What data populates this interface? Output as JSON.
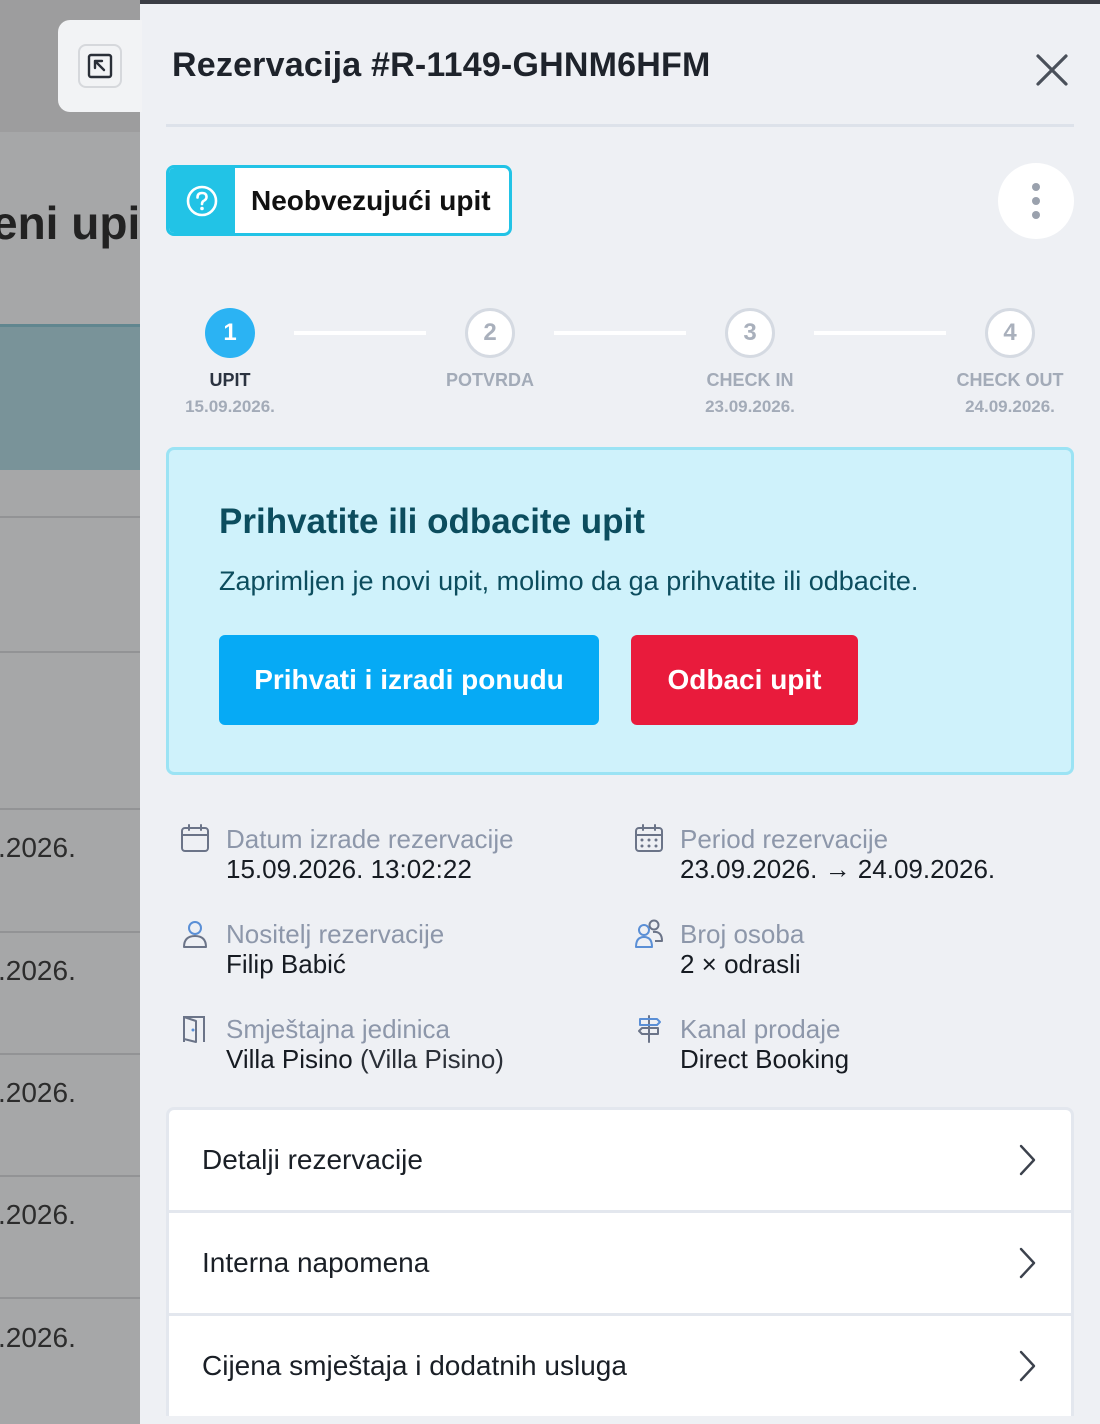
{
  "background": {
    "heading_fragment": "eni upi",
    "date_fragments": [
      ".2026.",
      ".2026.",
      ".2026.",
      ".2026.",
      ".2026."
    ]
  },
  "panel": {
    "title": "Rezervacija #R-1149-GHNM6HFM",
    "status_badge": {
      "label": "Neobvezujući upit",
      "icon": "question-circle-icon",
      "color": "#22c3e6"
    }
  },
  "stepper": [
    {
      "number": "1",
      "label": "UPIT",
      "date": "15.09.2026.",
      "active": true
    },
    {
      "number": "2",
      "label": "POTVRDA",
      "date": "",
      "active": false
    },
    {
      "number": "3",
      "label": "CHECK IN",
      "date": "23.09.2026.",
      "active": false
    },
    {
      "number": "4",
      "label": "CHECK OUT",
      "date": "24.09.2026.",
      "active": false
    }
  ],
  "alert": {
    "title": "Prihvatite ili odbacite upit",
    "text": "Zaprimljen je novi upit, molimo da ga prihvatite ili odbacite.",
    "accept_label": "Prihvati i izradi ponudu",
    "reject_label": "Odbaci upit"
  },
  "info": {
    "created": {
      "label": "Datum izrade rezervacije",
      "value": "15.09.2026. 13:02:22",
      "icon": "calendar-icon"
    },
    "period": {
      "label": "Period rezervacije",
      "value": "23.09.2026. → 24.09.2026.",
      "icon": "calendar-grid-icon"
    },
    "holder": {
      "label": "Nositelj rezervacije",
      "value": "Filip Babić",
      "icon": "user-icon"
    },
    "guests": {
      "label": "Broj osoba",
      "value": "2 × odrasli",
      "icon": "users-icon"
    },
    "unit": {
      "label": "Smještajna jedinica",
      "value": "Villa Pisino",
      "value_suffix": "(Villa Pisino)",
      "icon": "door-icon"
    },
    "channel": {
      "label": "Kanal prodaje",
      "value": "Direct Booking",
      "icon": "signpost-icon"
    }
  },
  "sections": [
    "Detalji rezervacije",
    "Interna napomena",
    "Cijena smještaja i dodatnih usluga"
  ],
  "colors": {
    "accent": "#06aaf5",
    "danger": "#e91b3c",
    "step_active": "#2bb3f3",
    "alert_bg": "#cff2fb"
  }
}
